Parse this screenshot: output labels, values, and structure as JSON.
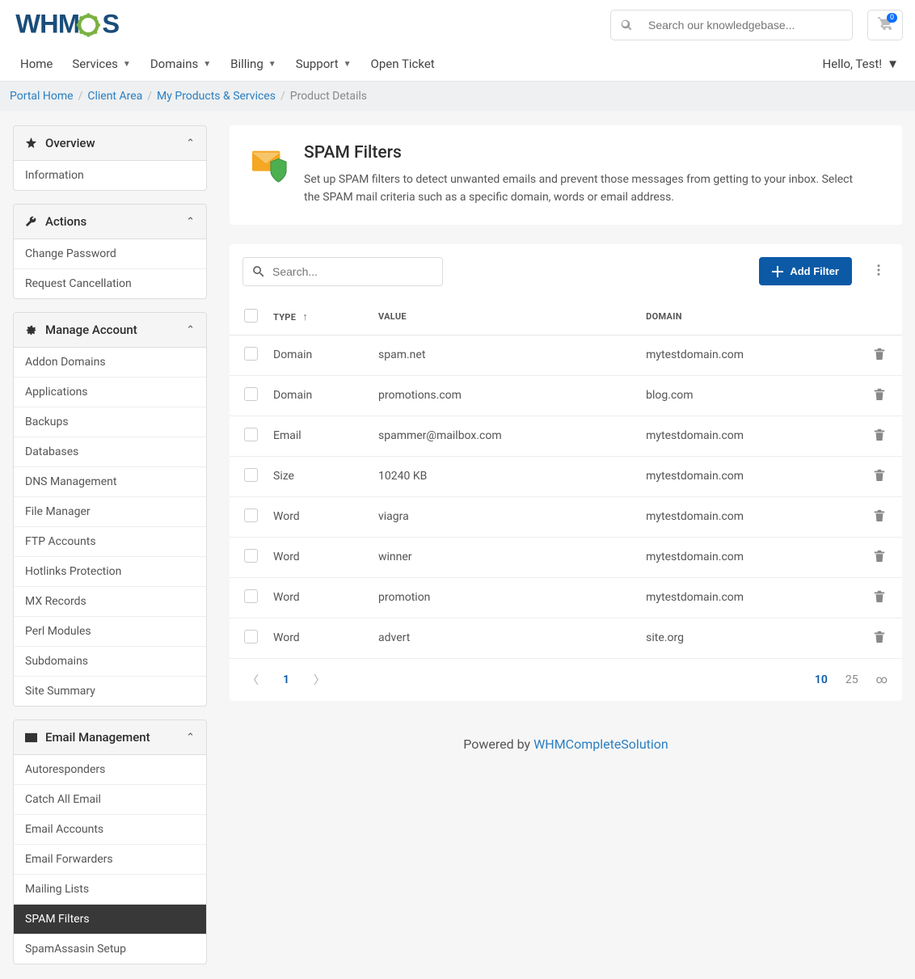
{
  "header": {
    "search_placeholder": "Search our knowledgebase...",
    "cart_count": "0"
  },
  "nav": {
    "items": [
      {
        "label": "Home",
        "dropdown": false
      },
      {
        "label": "Services",
        "dropdown": true
      },
      {
        "label": "Domains",
        "dropdown": true
      },
      {
        "label": "Billing",
        "dropdown": true
      },
      {
        "label": "Support",
        "dropdown": true
      },
      {
        "label": "Open Ticket",
        "dropdown": false
      }
    ],
    "user": "Hello, Test!"
  },
  "breadcrumb": {
    "items": [
      {
        "label": "Portal Home",
        "link": true
      },
      {
        "label": "Client Area",
        "link": true
      },
      {
        "label": "My Products & Services",
        "link": true
      },
      {
        "label": "Product Details",
        "link": false
      }
    ]
  },
  "sidebar": {
    "panels": [
      {
        "title": "Overview",
        "icon": "star",
        "items": [
          "Information"
        ]
      },
      {
        "title": "Actions",
        "icon": "wrench",
        "items": [
          "Change Password",
          "Request Cancellation"
        ]
      },
      {
        "title": "Manage Account",
        "icon": "gear",
        "items": [
          "Addon Domains",
          "Applications",
          "Backups",
          "Databases",
          "DNS Management",
          "File Manager",
          "FTP Accounts",
          "Hotlinks Protection",
          "MX Records",
          "Perl Modules",
          "Subdomains",
          "Site Summary"
        ]
      },
      {
        "title": "Email Management",
        "icon": "mail",
        "items": [
          "Autoresponders",
          "Catch All Email",
          "Email Accounts",
          "Email Forwarders",
          "Mailing Lists",
          "SPAM Filters",
          "SpamAssasin Setup"
        ],
        "active": "SPAM Filters"
      }
    ]
  },
  "page": {
    "title": "SPAM Filters",
    "desc": "Set up SPAM filters to detect unwanted emails and prevent those messages from getting to your inbox. Select the SPAM mail criteria such as a specific domain, words or email address."
  },
  "table": {
    "search_placeholder": "Search...",
    "add_label": "Add Filter",
    "columns": {
      "type": "TYPE",
      "value": "VALUE",
      "domain": "DOMAIN"
    },
    "rows": [
      {
        "type": "Domain",
        "value": "spam.net",
        "domain": "mytestdomain.com"
      },
      {
        "type": "Domain",
        "value": "promotions.com",
        "domain": "blog.com"
      },
      {
        "type": "Email",
        "value": "spammer@mailbox.com",
        "domain": "mytestdomain.com"
      },
      {
        "type": "Size",
        "value": "10240 KB",
        "domain": "mytestdomain.com"
      },
      {
        "type": "Word",
        "value": "viagra",
        "domain": "mytestdomain.com"
      },
      {
        "type": "Word",
        "value": "winner",
        "domain": "mytestdomain.com"
      },
      {
        "type": "Word",
        "value": "promotion",
        "domain": "mytestdomain.com"
      },
      {
        "type": "Word",
        "value": "advert",
        "domain": "site.org"
      }
    ],
    "pagination": {
      "current": "1",
      "sizes": [
        "10",
        "25",
        "∞"
      ],
      "active_size": "10"
    }
  },
  "footer": {
    "text": "Powered by ",
    "link": "WHMCompleteSolution"
  }
}
